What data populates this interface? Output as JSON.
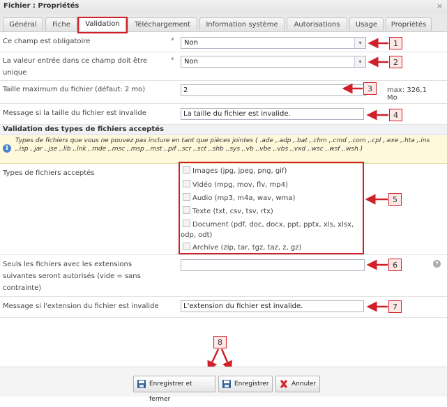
{
  "window": {
    "title": "Fichier : Propriétés",
    "close_icon": "×"
  },
  "tabs": [
    {
      "label": "Général"
    },
    {
      "label": "Fiche"
    },
    {
      "label": "Validation"
    },
    {
      "label": "Téléchargement"
    },
    {
      "label": "Information système"
    },
    {
      "label": "Autorisations"
    },
    {
      "label": "Usage"
    },
    {
      "label": "Propriétés"
    }
  ],
  "form": {
    "required": {
      "label": "Ce champ est obligatoire",
      "marker": "*",
      "value": "Non"
    },
    "unique": {
      "label_line1": "La valeur entrée dans ce champ doit être",
      "label_line2": "unique",
      "marker": "*",
      "value": "Non"
    },
    "max_size": {
      "label": "Taille maximum du fichier (défaut: 2 mo)",
      "value": "2",
      "hint_line1": "max: 326,1",
      "hint_line2": "Mo"
    },
    "size_message": {
      "label": "Message si la taille du fichier est invalide",
      "value": "La taille du fichier est invalide."
    }
  },
  "section": {
    "title": "Validation des types de fichiers acceptés",
    "info_text": "Types de fichiers que vous ne pouvez pas inclure en tant que pièces jointes ( .ade ,.adp ,.bat ,.chm ,.cmd ,.com ,.cpl ,.exe ,.hta ,.ins ,.isp ,.jar ,.jse ,.lib ,.lnk ,.mde ,.msc ,.msp ,.mst ,.pif ,.scr ,.sct ,.shb ,.sys ,.vb ,.vbe ,.vbs ,.vxd ,.wsc ,.wsf ,.wsh )",
    "types_label": "Types de fichiers acceptés",
    "types": [
      {
        "label": "Images (jpg, jpeg, png, gif)"
      },
      {
        "label": "Vidéo (mpg, mov, flv, mp4)"
      },
      {
        "label": "Audio (mp3, m4a, wav, wma)"
      },
      {
        "label": "Texte (txt, csv, tsv, rtx)"
      },
      {
        "label": "Document (pdf, doc, docx, ppt, pptx, xls, xlsx,",
        "label2": "odp, odt)"
      },
      {
        "label": "Archive (zip, tar, tgz, taz, z, gz)"
      }
    ],
    "extensions": {
      "label_line1": "Seuls les fichiers avec les extensions",
      "label_line2": "suivantes seront autorisés (vide = sans",
      "label_line3": "contrainte)",
      "value": ""
    },
    "ext_message": {
      "label": "Message si l'extension du fichier est invalide",
      "value": "L'extension du fichier est invalide."
    }
  },
  "callouts": [
    "1",
    "2",
    "3",
    "4",
    "5",
    "6",
    "7",
    "8"
  ],
  "buttons": {
    "save_close": "Enregistrer et fermer",
    "save": "Enregistrer",
    "cancel": "Annuler"
  },
  "colors": {
    "annotation_red": "#d0202a",
    "callout_bg": "#fde8e6",
    "info_bg": "#fff9dc"
  }
}
